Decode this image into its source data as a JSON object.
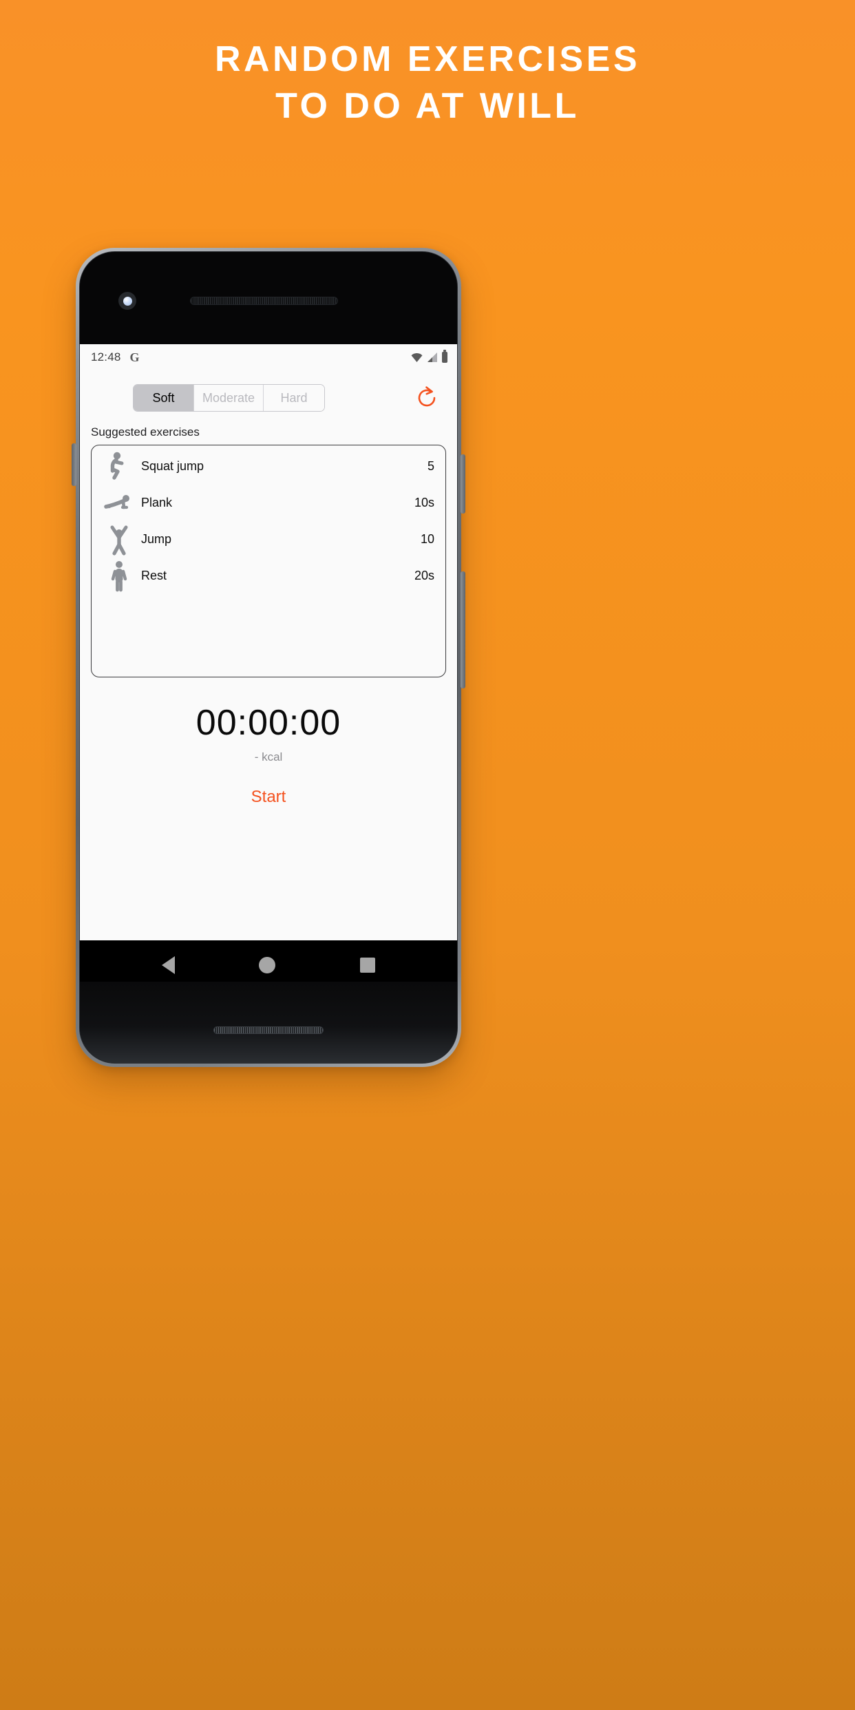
{
  "promo": {
    "headline_line1": "RANDOM EXERCISES",
    "headline_line2": "TO DO AT WILL",
    "background_color": "#F9941F",
    "headline_color": "#FFFFFF"
  },
  "phone": {
    "status_bar": {
      "time": "12:48",
      "google_icon": "G",
      "icons": [
        "wifi-icon",
        "signal-icon",
        "battery-icon"
      ]
    },
    "nav_bar": {
      "back": "back-triangle-icon",
      "home": "home-circle-icon",
      "recents": "recents-square-icon"
    }
  },
  "app": {
    "accent_color": "#F4511E",
    "difficulty": {
      "options": [
        "Soft",
        "Moderate",
        "Hard"
      ],
      "selected": "Soft"
    },
    "refresh_icon": "refresh-icon",
    "list_title": "Suggested exercises",
    "exercises": [
      {
        "icon": "squat-jump-icon",
        "name": "Squat jump",
        "value": "5"
      },
      {
        "icon": "plank-icon",
        "name": "Plank",
        "value": "10s"
      },
      {
        "icon": "jump-icon",
        "name": "Jump",
        "value": "10"
      },
      {
        "icon": "rest-icon",
        "name": "Rest",
        "value": "20s"
      }
    ],
    "timer": "00:00:00",
    "calories": "- kcal",
    "start_label": "Start"
  }
}
